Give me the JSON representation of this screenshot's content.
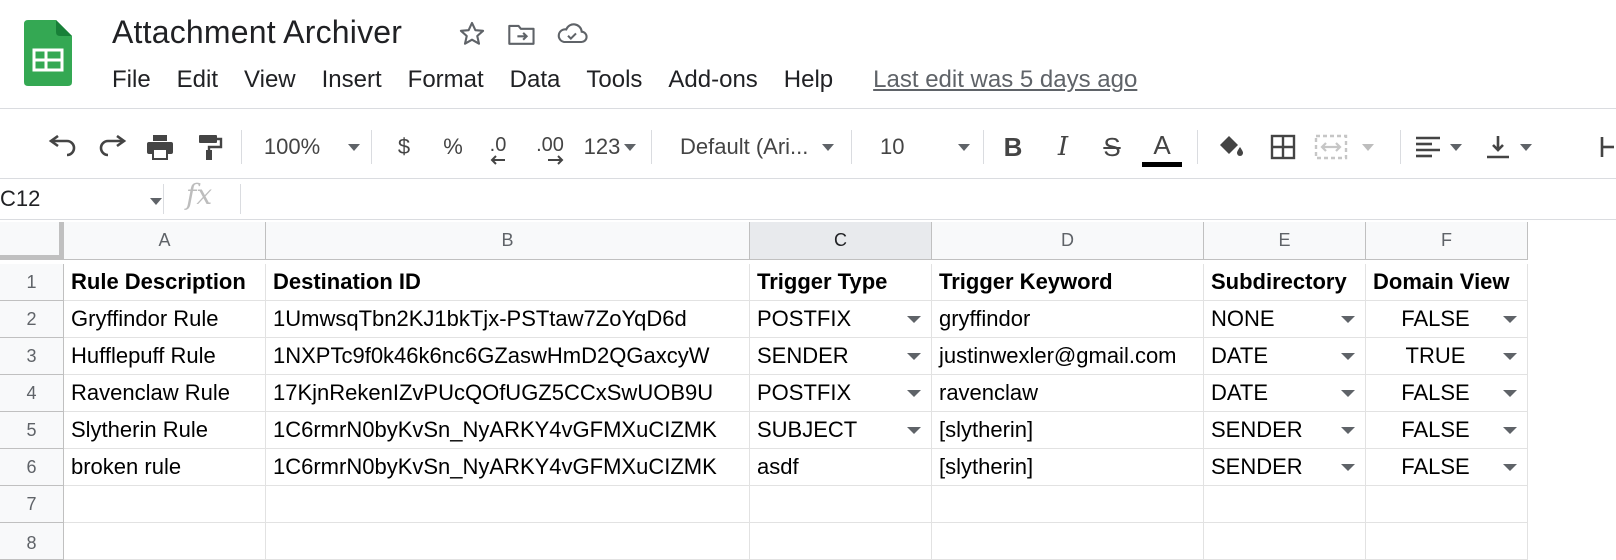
{
  "app": {
    "title": "Attachment Archiver",
    "logo_icon": "google-sheets-logo",
    "title_icons": [
      "star-icon",
      "move-to-folder-icon",
      "cloud-saved-icon"
    ]
  },
  "menu": {
    "items": [
      "File",
      "Edit",
      "View",
      "Insert",
      "Format",
      "Data",
      "Tools",
      "Add-ons",
      "Help"
    ],
    "last_edit": "Last edit was 5 days ago"
  },
  "toolbar": {
    "zoom": "100%",
    "currency": "$",
    "percent": "%",
    "decrease_decimal": ".0",
    "increase_decimal": ".00",
    "more_formats": "123",
    "font": "Default (Ari...",
    "font_size": "10"
  },
  "formula_bar": {
    "cell_ref": "C12",
    "fx_label": "fx",
    "content": ""
  },
  "sheet": {
    "columns": [
      "A",
      "B",
      "C",
      "D",
      "E",
      "F"
    ],
    "selected_column": "C",
    "row_numbers": [
      "1",
      "2",
      "3",
      "4",
      "5",
      "6",
      "7",
      "8"
    ],
    "header": [
      "Rule Description",
      "Destination ID",
      "Trigger Type",
      "Trigger Keyword",
      "Subdirectory",
      "Domain View"
    ],
    "rows": [
      [
        "Gryffindor Rule",
        "1UmwsqTbn2KJ1bkTjx-PSTtaw7ZoYqD6d",
        "POSTFIX",
        "gryffindor",
        "NONE",
        "FALSE"
      ],
      [
        "Hufflepuff Rule",
        "1NXPTc9f0k46k6nc6GZaswHmD2QGaxcyW",
        "SENDER",
        "justinwexler@gmail.com",
        "DATE",
        "TRUE"
      ],
      [
        "Ravenclaw Rule",
        "17KjnRekenIZvPUcQOfUGZ5CCxSwUOB9U",
        "POSTFIX",
        "ravenclaw",
        "DATE",
        "FALSE"
      ],
      [
        "Slytherin Rule",
        "1C6rmrN0byKvSn_NyARKY4vGFMXuCIZMK",
        "SUBJECT",
        "[slytherin]",
        "SENDER",
        "FALSE"
      ],
      [
        "broken rule",
        "1C6rmrN0byKvSn_NyARKY4vGFMXuCIZMK",
        "asdf",
        "[slytherin]",
        "SENDER",
        "FALSE"
      ]
    ],
    "dropdowns": [
      [
        false,
        false,
        true,
        false,
        true,
        true
      ],
      [
        false,
        false,
        true,
        false,
        true,
        true
      ],
      [
        false,
        false,
        true,
        false,
        true,
        true
      ],
      [
        false,
        false,
        true,
        false,
        true,
        true
      ],
      [
        false,
        false,
        false,
        false,
        true,
        true
      ]
    ]
  }
}
